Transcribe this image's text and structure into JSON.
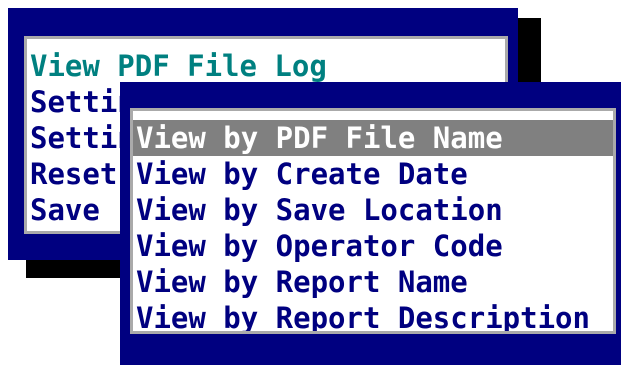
{
  "colors": {
    "panel_bg": "#000080",
    "frame": "#aaaaaa",
    "menu_bg": "#ffffff",
    "text": "#000080",
    "accent_text": "#008080",
    "selection_bg": "#808080",
    "selection_text": "#ffffff",
    "shadow": "#000000"
  },
  "main_menu": {
    "items": [
      {
        "label": "View PDF File Log"
      },
      {
        "label": "Settings"
      },
      {
        "label": "Settings"
      },
      {
        "label": "Reset"
      },
      {
        "label": "Save"
      }
    ]
  },
  "submenu": {
    "selected_index": 0,
    "items": [
      {
        "label": "View by PDF File Name"
      },
      {
        "label": "View by Create Date"
      },
      {
        "label": "View by Save Location"
      },
      {
        "label": "View by Operator Code"
      },
      {
        "label": "View by Report Name"
      },
      {
        "label": "View by Report Description"
      }
    ]
  }
}
